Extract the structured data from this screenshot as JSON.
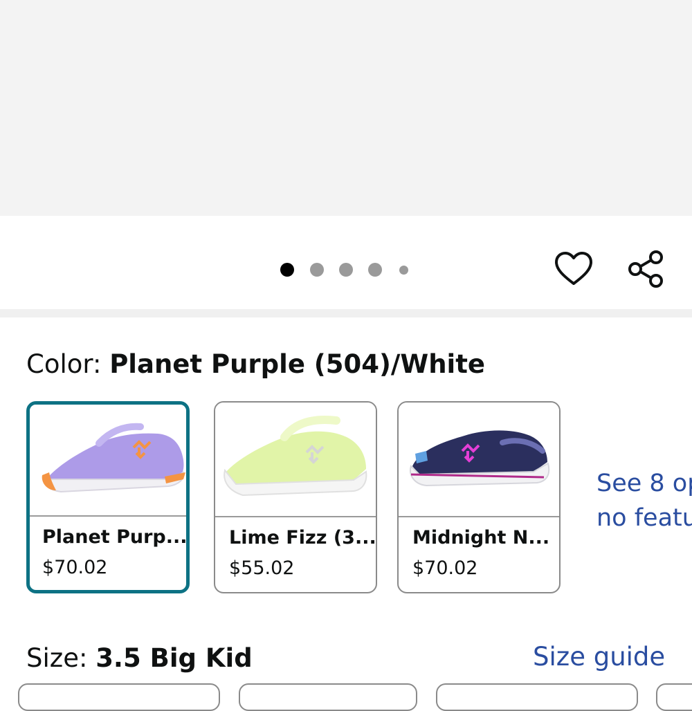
{
  "carousel": {
    "dot_count": 5,
    "active_index": 0
  },
  "actions": {
    "wishlist_icon": "heart-outline-icon",
    "share_icon": "share-icon"
  },
  "color": {
    "label": "Color: ",
    "selected_value": "Planet Purple (504)/White",
    "options": [
      {
        "name": "Planet Purp...",
        "price": "$70.02",
        "image": "purple-running-shoe"
      },
      {
        "name": "Lime Fizz (3...",
        "price": "$55.02",
        "image": "lime-running-shoe"
      },
      {
        "name": "Midnight N...",
        "price": "$70.02",
        "image": "navy-running-shoe"
      }
    ],
    "see_more_line1": "See 8 op",
    "see_more_line2": "no featu"
  },
  "size": {
    "label": "Size: ",
    "selected_value": "3.5 Big Kid",
    "guide_link": "Size guide"
  },
  "colors": {
    "accent_border": "#0d7284",
    "link": "#2a4da0"
  }
}
